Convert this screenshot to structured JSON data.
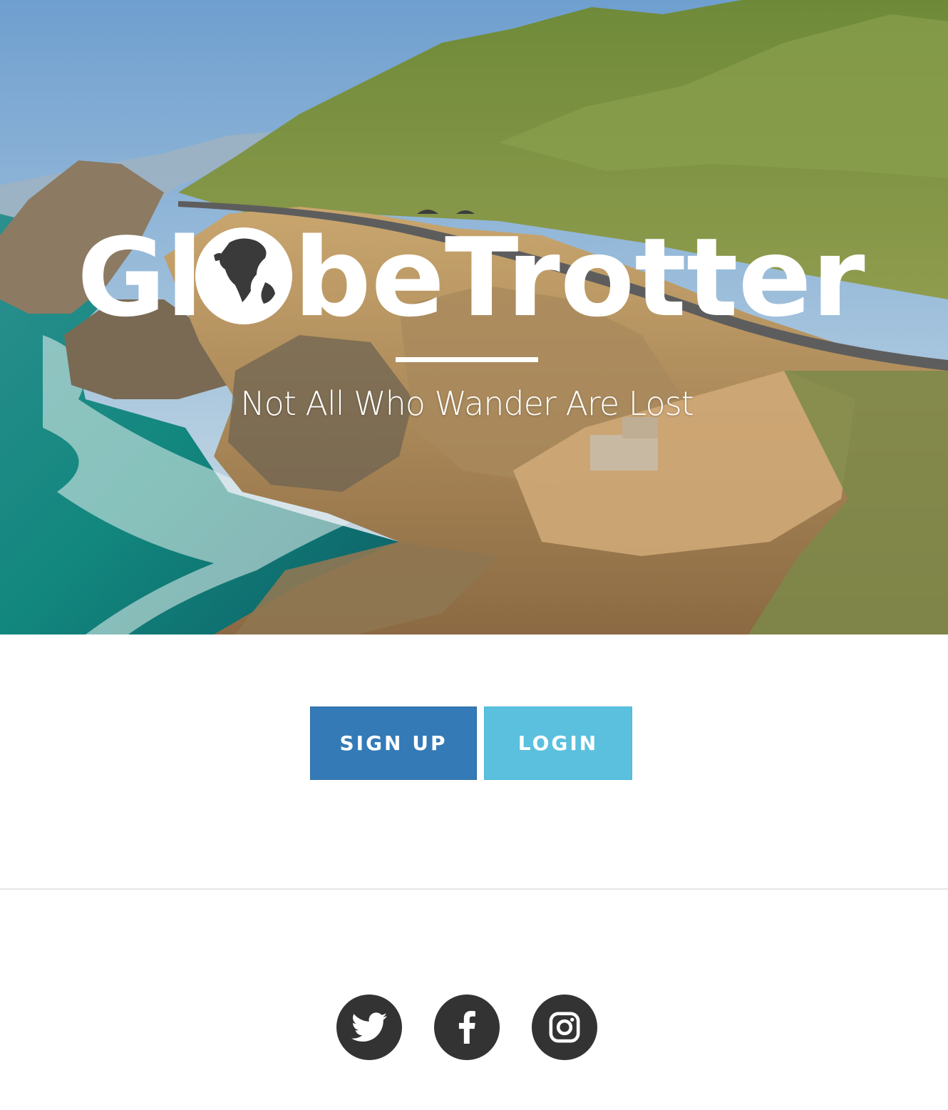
{
  "hero": {
    "logo": {
      "part1": "Gl",
      "part2": "beTrotter"
    },
    "tagline": "Not All Who Wander Are Lost",
    "colors": {
      "sky": "#9fc3e0",
      "ocean": "#1e8a86",
      "hills": "#7a8f3c",
      "cliffs": "#b08a58"
    }
  },
  "actions": {
    "signup_label": "SIGN UP",
    "login_label": "LOGIN",
    "colors": {
      "signup": "#337ab7",
      "login": "#5bc0de"
    }
  },
  "social": {
    "icons": [
      "twitter-icon",
      "facebook-icon",
      "instagram-icon"
    ],
    "color": "#333333"
  }
}
